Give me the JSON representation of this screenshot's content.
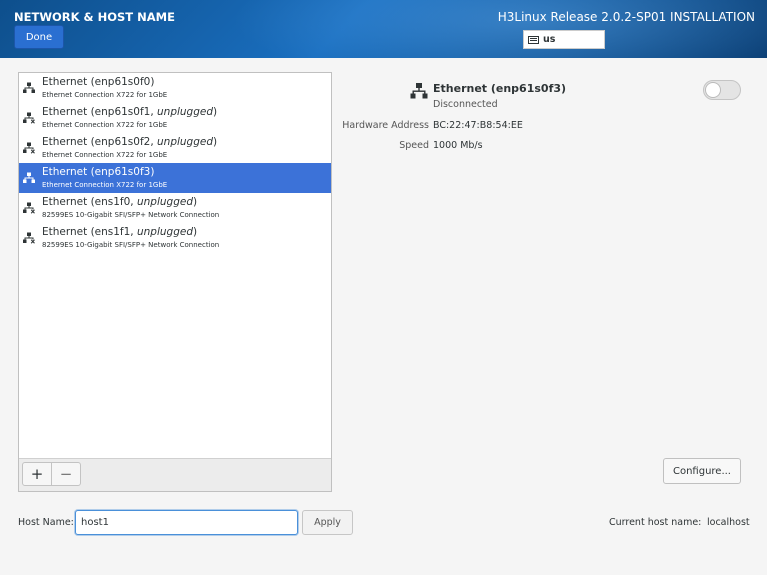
{
  "header": {
    "title": "NETWORK & HOST NAME",
    "done_label": "Done",
    "product": "H3Linux Release 2.0.2-SP01 INSTALLATION",
    "keyboard_layout": "us"
  },
  "devices": [
    {
      "name": "Ethernet (enp61s0f0)",
      "state": "",
      "description": "Ethernet Connection X722 for 1GbE",
      "selected": false,
      "icon": "wired-network-icon"
    },
    {
      "name": "Ethernet (enp61s0f1, ",
      "state": "unplugged",
      "description": "Ethernet Connection X722 for 1GbE",
      "selected": false,
      "icon": "wired-network-unplugged-icon"
    },
    {
      "name": "Ethernet (enp61s0f2, ",
      "state": "unplugged",
      "description": "Ethernet Connection X722 for 1GbE",
      "selected": false,
      "icon": "wired-network-unplugged-icon"
    },
    {
      "name": "Ethernet (enp61s0f3)",
      "state": "",
      "description": "Ethernet Connection X722 for 1GbE",
      "selected": true,
      "icon": "wired-network-icon"
    },
    {
      "name": "Ethernet (ens1f0, ",
      "state": "unplugged",
      "description": "82599ES 10-Gigabit SFI/SFP+ Network Connection",
      "selected": false,
      "icon": "wired-network-unplugged-icon"
    },
    {
      "name": "Ethernet (ens1f1, ",
      "state": "unplugged",
      "description": "82599ES 10-Gigabit SFI/SFP+ Network Connection",
      "selected": false,
      "icon": "wired-network-unplugged-icon"
    }
  ],
  "list_toolbar": {
    "add_label": "+",
    "remove_label": "−"
  },
  "detail": {
    "name": "Ethernet (enp61s0f3)",
    "status": "Disconnected",
    "toggle_on": false,
    "hardware_address_label": "Hardware Address",
    "hardware_address": "BC:22:47:B8:54:EE",
    "speed_label": "Speed",
    "speed": "1000 Mb/s",
    "configure_label": "Configure..."
  },
  "hostname": {
    "label": "Host Name:",
    "value": "host1",
    "apply_label": "Apply",
    "current_label": "Current host name:",
    "current_value": "localhost"
  },
  "colors": {
    "accent": "#3c72d8",
    "header": "#1a6fc0"
  }
}
